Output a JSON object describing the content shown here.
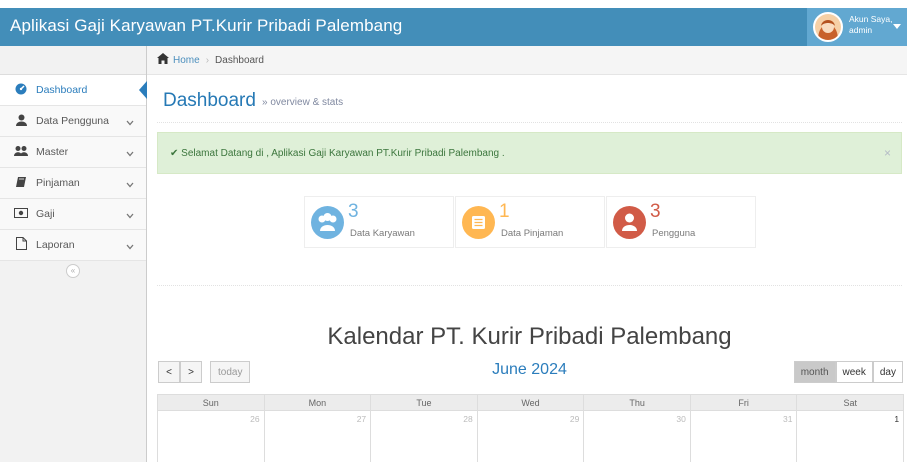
{
  "navbar": {
    "brand": "Aplikasi Gaji Karyawan PT.Kurir Pribadi Palembang",
    "user_line1": "Akun Saya,",
    "user_line2": "admin"
  },
  "sidebar": {
    "items": [
      {
        "label": "Dashboard",
        "icon": "dashboard-icon",
        "active": true
      },
      {
        "label": "Data Pengguna",
        "icon": "user-icon",
        "has_chevron": true
      },
      {
        "label": "Master",
        "icon": "users-icon",
        "has_chevron": true
      },
      {
        "label": "Pinjaman",
        "icon": "book-icon",
        "has_chevron": true
      },
      {
        "label": "Gaji",
        "icon": "money-icon",
        "has_chevron": true
      },
      {
        "label": "Laporan",
        "icon": "file-icon",
        "has_chevron": true
      }
    ],
    "collapse_icon": "double-chevron-left-icon"
  },
  "breadcrumb": {
    "home": "Home",
    "current": "Dashboard"
  },
  "page": {
    "title": "Dashboard",
    "subtitle": "» overview & stats"
  },
  "alert": {
    "text": "✔ Selamat Datang di , Aplikasi Gaji Karyawan PT.Kurir Pribadi Palembang .",
    "close": "×"
  },
  "stats": [
    {
      "value": "3",
      "label": "Data Karyawan",
      "color": "#6fb3e0",
      "icon": "users-icon"
    },
    {
      "value": "1",
      "label": "Data Pinjaman",
      "color": "#ffb752",
      "icon": "list-icon"
    },
    {
      "value": "3",
      "label": "Pengguna",
      "color": "#d15b47",
      "icon": "user-icon"
    }
  ],
  "calendar": {
    "title": "Kalendar PT. Kurir Pribadi Palembang",
    "month": "June 2024",
    "prev": "<",
    "next": ">",
    "today": "today",
    "views": [
      "month",
      "week",
      "day"
    ],
    "days": [
      "Sun",
      "Mon",
      "Tue",
      "Wed",
      "Thu",
      "Fri",
      "Sat"
    ],
    "first_row": [
      "26",
      "27",
      "28",
      "29",
      "30",
      "31",
      "1"
    ]
  },
  "colors": {
    "navbar": "#438eb9",
    "accent": "#2b7dbc",
    "alert_bg": "#dff0d8",
    "alert_text": "#3c763d"
  }
}
